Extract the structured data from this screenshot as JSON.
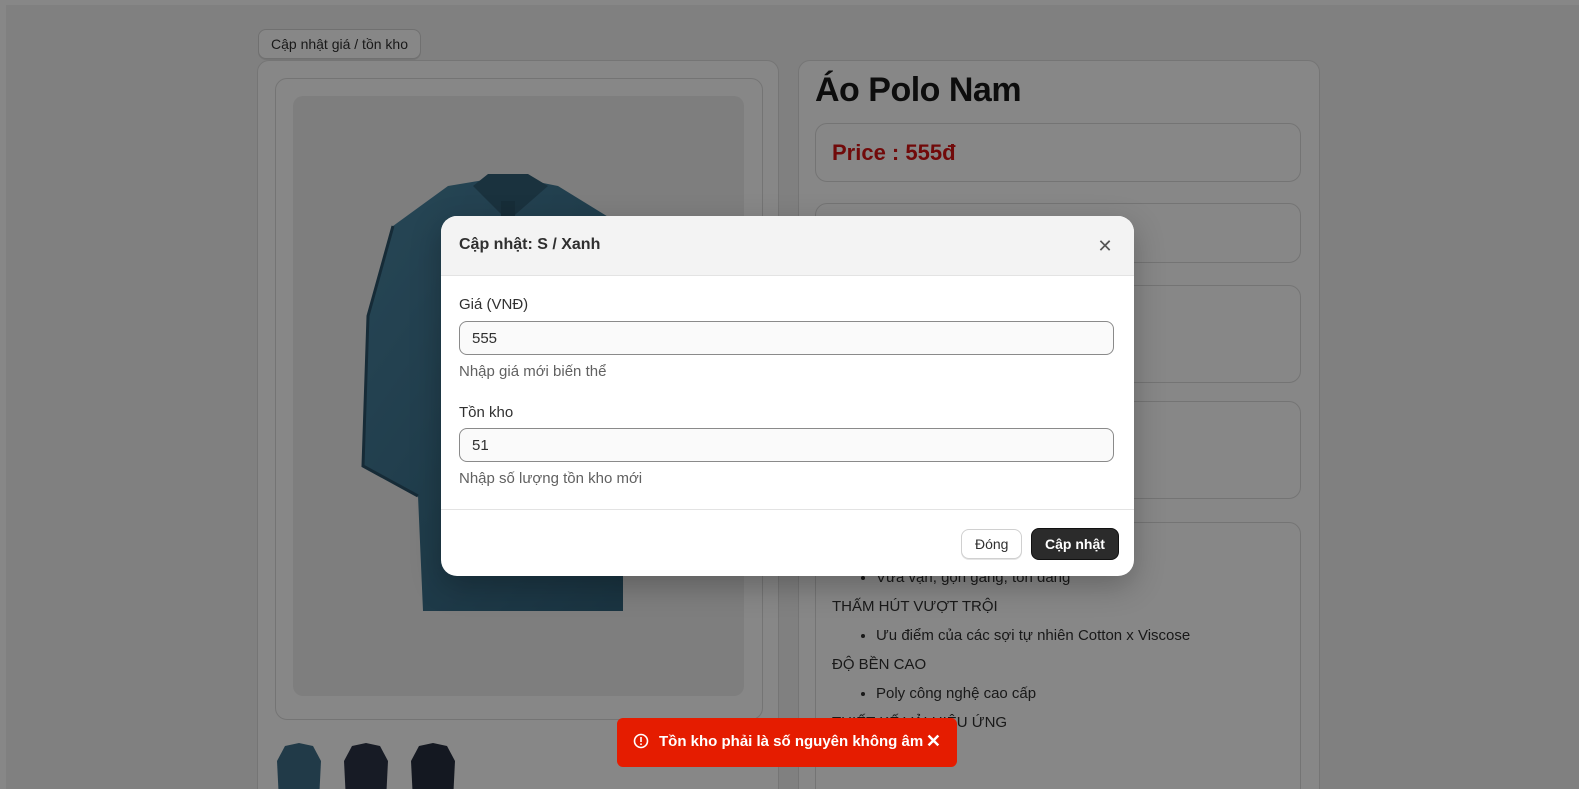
{
  "header": {
    "button_label": "Cập nhật giá / tồn kho"
  },
  "product": {
    "title": "Áo Polo Nam",
    "price_label": "Price : 555đ",
    "description": [
      {
        "heading": "",
        "bullets": [
          "Vừa vặn, gọn gàng, tôn dáng"
        ]
      },
      {
        "heading": "THẤM HÚT VƯỢT TRỘI",
        "bullets": [
          "Ưu điểm của các sợi tự nhiên Cotton x Viscose"
        ]
      },
      {
        "heading": "ĐỘ BỀN CAO",
        "bullets": [
          "Poly công nghệ cao cấp"
        ]
      },
      {
        "heading": "THIẾT KẾ VẢI HIỆU ỨNG",
        "bullets": []
      }
    ]
  },
  "modal": {
    "title": "Cập nhật: S / Xanh",
    "close_icon": "close-icon",
    "price_field": {
      "label": "Giá (VNĐ)",
      "value": "555",
      "help": "Nhập giá mới biến thể"
    },
    "stock_field": {
      "label": "Tồn kho",
      "value": "51",
      "help": "Nhập số lượng tồn kho mới"
    },
    "cancel_label": "Đóng",
    "submit_label": "Cập nhật"
  },
  "toast": {
    "icon": "error-circle-icon",
    "message": "Tồn kho phải là số nguyên không âm",
    "close_icon": "close-icon",
    "color": "#e51c00"
  },
  "colors": {
    "price": "#d51414",
    "shirt": "#3f6f88",
    "overlay": "rgba(0,0,0,0.47)"
  }
}
